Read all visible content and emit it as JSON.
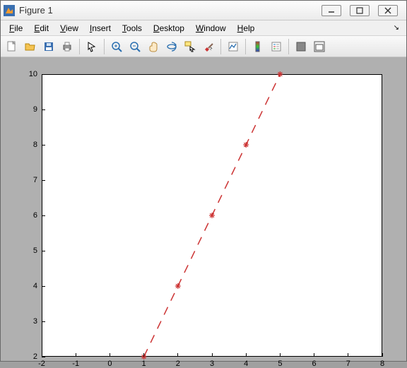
{
  "window": {
    "title": "Figure 1"
  },
  "menu": {
    "file": {
      "label": "File",
      "ukey": "F"
    },
    "edit": {
      "label": "Edit",
      "ukey": "E"
    },
    "view": {
      "label": "View",
      "ukey": "V"
    },
    "insert": {
      "label": "Insert",
      "ukey": "I"
    },
    "tools": {
      "label": "Tools",
      "ukey": "T"
    },
    "desktop": {
      "label": "Desktop",
      "ukey": "D"
    },
    "window": {
      "label": "Window",
      "ukey": "W"
    },
    "help": {
      "label": "Help",
      "ukey": "H"
    }
  },
  "toolbar_icons": {
    "new": "new-figure",
    "open": "open-file",
    "save": "save",
    "print": "print",
    "arrow": "edit-plot",
    "zoomin": "zoom-in",
    "zoomout": "zoom-out",
    "pan": "pan",
    "rotate": "rotate-3d",
    "datacursor": "data-cursor",
    "brush": "brush",
    "link": "link-plot",
    "colorbar": "insert-colorbar",
    "legend": "insert-legend",
    "hide": "hide-tools",
    "dock": "dock-figure"
  },
  "chart_data": {
    "type": "line",
    "x": [
      1,
      2,
      3,
      4,
      5
    ],
    "y": [
      2,
      4,
      6,
      8,
      10
    ],
    "line_style": "dashed",
    "line_color": "#cc3333",
    "marker": "*",
    "marker_color": "#cc3333",
    "xlim": [
      -2,
      8
    ],
    "ylim": [
      2,
      10
    ],
    "xticks": [
      -2,
      -1,
      0,
      1,
      2,
      3,
      4,
      5,
      6,
      7,
      8
    ],
    "yticks": [
      2,
      3,
      4,
      5,
      6,
      7,
      8,
      9,
      10
    ],
    "title": "",
    "xlabel": "",
    "ylabel": ""
  }
}
